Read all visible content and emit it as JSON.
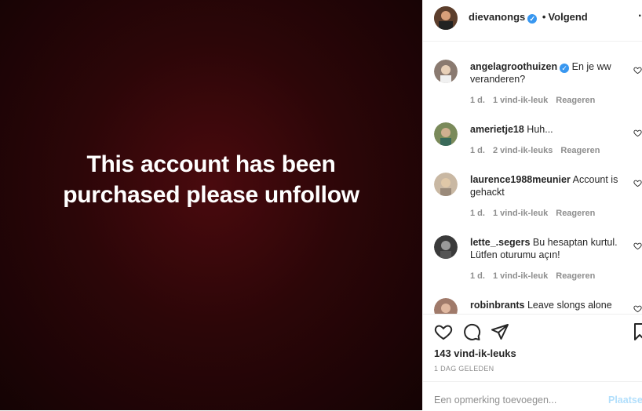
{
  "media": {
    "line1": "This account has been",
    "line2": "purchased please unfollow"
  },
  "header": {
    "username": "dievanongs",
    "verified": true,
    "separator": "•",
    "follow_label": "Volgend",
    "more_icon": "more-icon"
  },
  "comments": [
    {
      "user": "angelagroothuizen",
      "verified": true,
      "text": "En je ww veranderen?",
      "time": "1 d.",
      "likes": "1 vind-ik-leuk",
      "reply": "Reageren",
      "avatar_color": "#8a7a70"
    },
    {
      "user": "amerietje18",
      "verified": false,
      "text": "Huh...",
      "time": "1 d.",
      "likes": "2 vind-ik-leuks",
      "reply": "Reageren",
      "avatar_color": "#7a8a5a"
    },
    {
      "user": "laurence1988meunier",
      "verified": false,
      "text": "Account is gehackt",
      "time": "1 d.",
      "likes": "1 vind-ik-leuk",
      "reply": "Reageren",
      "avatar_color": "#c9b8a3"
    },
    {
      "user": "lette_.segers",
      "verified": false,
      "text": "Bu hesaptan kurtul. Lütfen oturumu açın!",
      "time": "1 d.",
      "likes": "1 vind-ik-leuk",
      "reply": "Reageren",
      "avatar_color": "#3a3a3a"
    },
    {
      "user": "robinbrants",
      "verified": false,
      "text": "Leave slongs alone",
      "avatar_color": "#a07a6a"
    }
  ],
  "actions": {
    "likes_count": "143 vind-ik-leuks",
    "date": "1 DAG GELEDEN"
  },
  "add_comment": {
    "placeholder": "Een opmerking toevoegen...",
    "post_label": "Plaatsen"
  },
  "colors": {
    "verified": "#3897f0",
    "post_button": "#b2dffc",
    "meta": "#8e8e8e",
    "text": "#262626"
  }
}
